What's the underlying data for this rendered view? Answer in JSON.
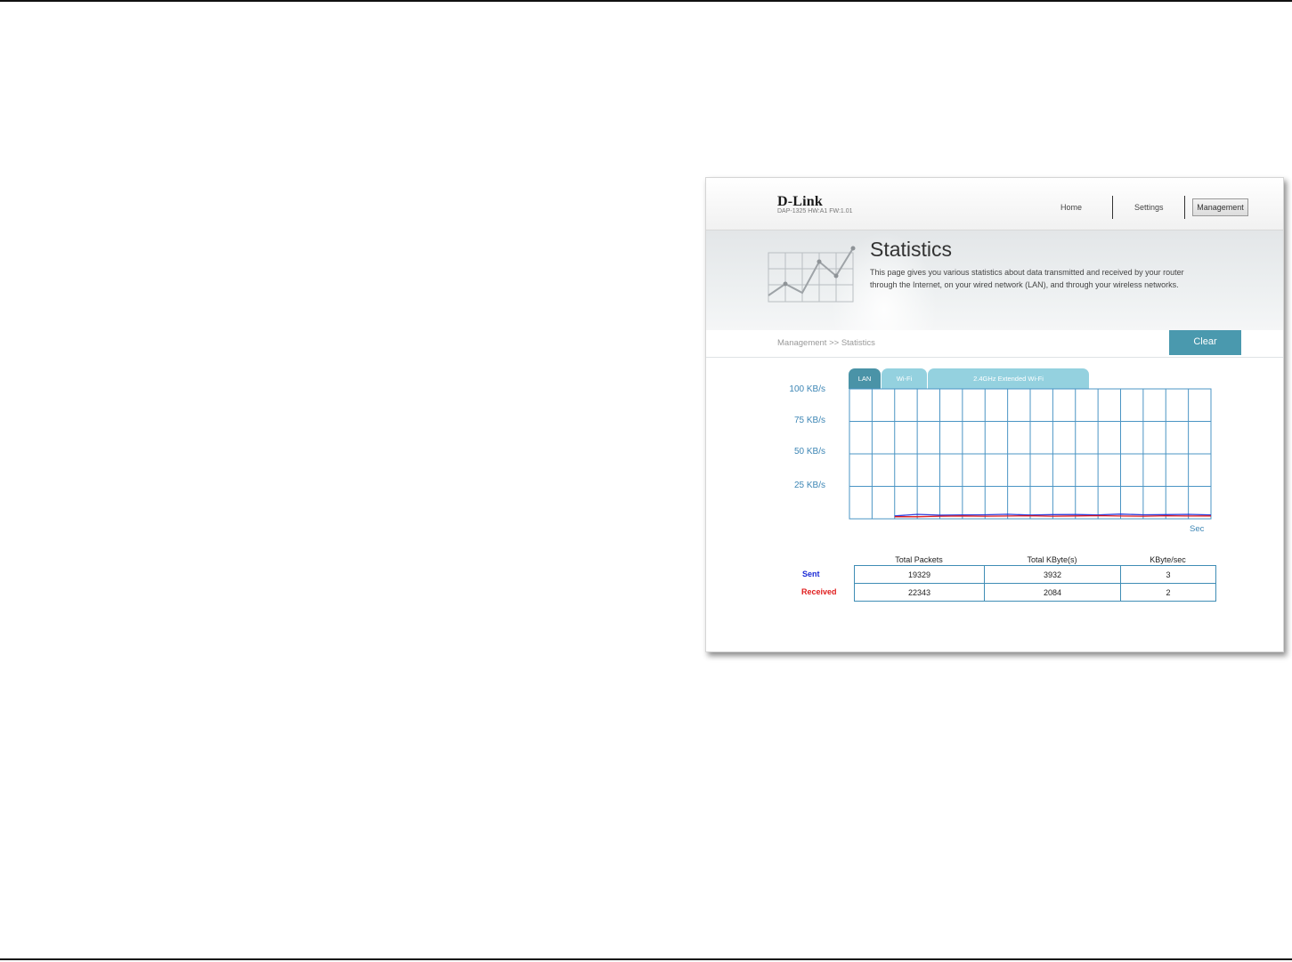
{
  "header": {
    "brand": "D-Link",
    "model_info": "DAP-1325   HW:A1   FW:1.01",
    "nav": {
      "home": "Home",
      "settings": "Settings",
      "management": "Management"
    }
  },
  "banner": {
    "title": "Statistics",
    "description": "This page gives you various statistics about data transmitted and received by your router through the Internet, on your wired network (LAN), and through your wireless networks."
  },
  "breadcrumb": "Management >> Statistics",
  "clear_label": "Clear",
  "tabs": [
    "LAN",
    "Wi-Fi",
    "2.4GHz Extended Wi-Fi"
  ],
  "chart_data": {
    "type": "line",
    "yticks": [
      "100 KB/s",
      "75 KB/s",
      "50 KB/s",
      "25 KB/s"
    ],
    "xlabel": "Sec",
    "ylim": [
      0,
      100
    ],
    "x": [
      0,
      1,
      2,
      3,
      4,
      5,
      6,
      7,
      8,
      9,
      10,
      11,
      12,
      13,
      14,
      15,
      16
    ],
    "series": [
      {
        "color": "#2a35d8",
        "values": [
          null,
          null,
          2.2,
          3.4,
          2.8,
          3.0,
          3.1,
          3.5,
          2.9,
          3.2,
          3.3,
          3.0,
          3.6,
          3.1,
          3.2,
          3.4,
          3.0
        ]
      },
      {
        "color": "#e01d1d",
        "values": [
          null,
          null,
          1.6,
          1.6,
          2.0,
          2.2,
          2.0,
          2.1,
          2.3,
          2.0,
          2.2,
          2.4,
          2.1,
          2.0,
          2.3,
          2.1,
          2.2
        ]
      }
    ]
  },
  "table": {
    "headers": [
      "Total Packets",
      "Total KByte(s)",
      "KByte/sec"
    ],
    "rows": [
      {
        "label": "Sent",
        "label_color": "#1a2ad6",
        "values": [
          "19329",
          "3932",
          "3"
        ]
      },
      {
        "label": "Received",
        "label_color": "#e01d1d",
        "values": [
          "22343",
          "2084",
          "2"
        ]
      }
    ]
  }
}
